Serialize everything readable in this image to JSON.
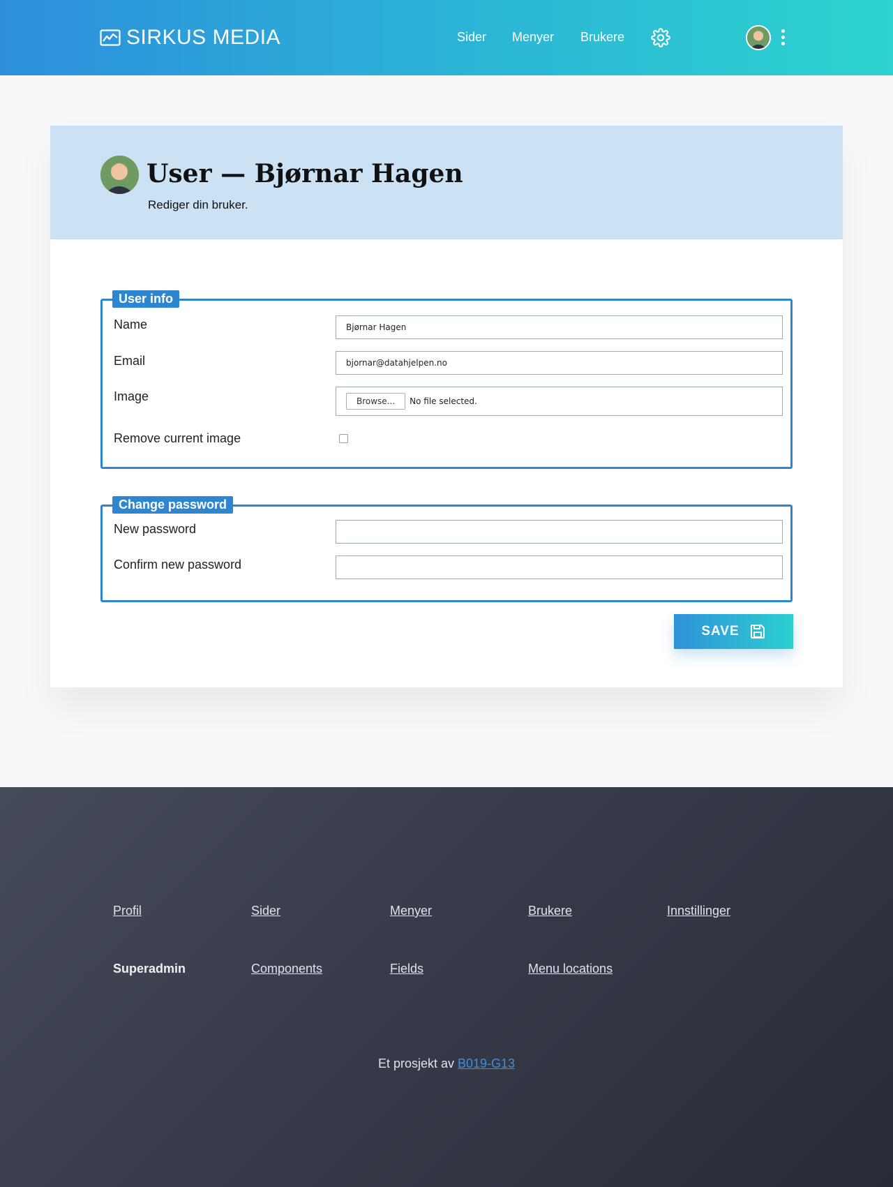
{
  "header": {
    "brand": "SIRKUS MEDIA",
    "nav": [
      "Sider",
      "Menyer",
      "Brukere"
    ],
    "colors": {
      "gradient_start": "#2d8fdc",
      "gradient_end": "#2dd3d0"
    }
  },
  "page": {
    "title": "User — Bjørnar Hagen",
    "subtitle": "Rediger din bruker."
  },
  "user_info": {
    "legend": "User info",
    "name_label": "Name",
    "name_value": "Bjørnar Hagen",
    "email_label": "Email",
    "email_value": "bjornar@datahjelpen.no",
    "image_label": "Image",
    "browse_label": "Browse...",
    "file_status": "No file selected.",
    "remove_label": "Remove current image",
    "remove_checked": false
  },
  "password": {
    "legend": "Change password",
    "new_label": "New password",
    "confirm_label": "Confirm new password"
  },
  "save_label": "SAVE",
  "footer": {
    "row1": [
      "Profil",
      "Sider",
      "Menyer",
      "Brukere",
      "Innstillinger"
    ],
    "row2_heading": "Superadmin",
    "row2": [
      "Components",
      "Fields",
      "Menu locations"
    ],
    "credit_prefix": "Et prosjekt av",
    "credit_link": "B019-G13"
  }
}
